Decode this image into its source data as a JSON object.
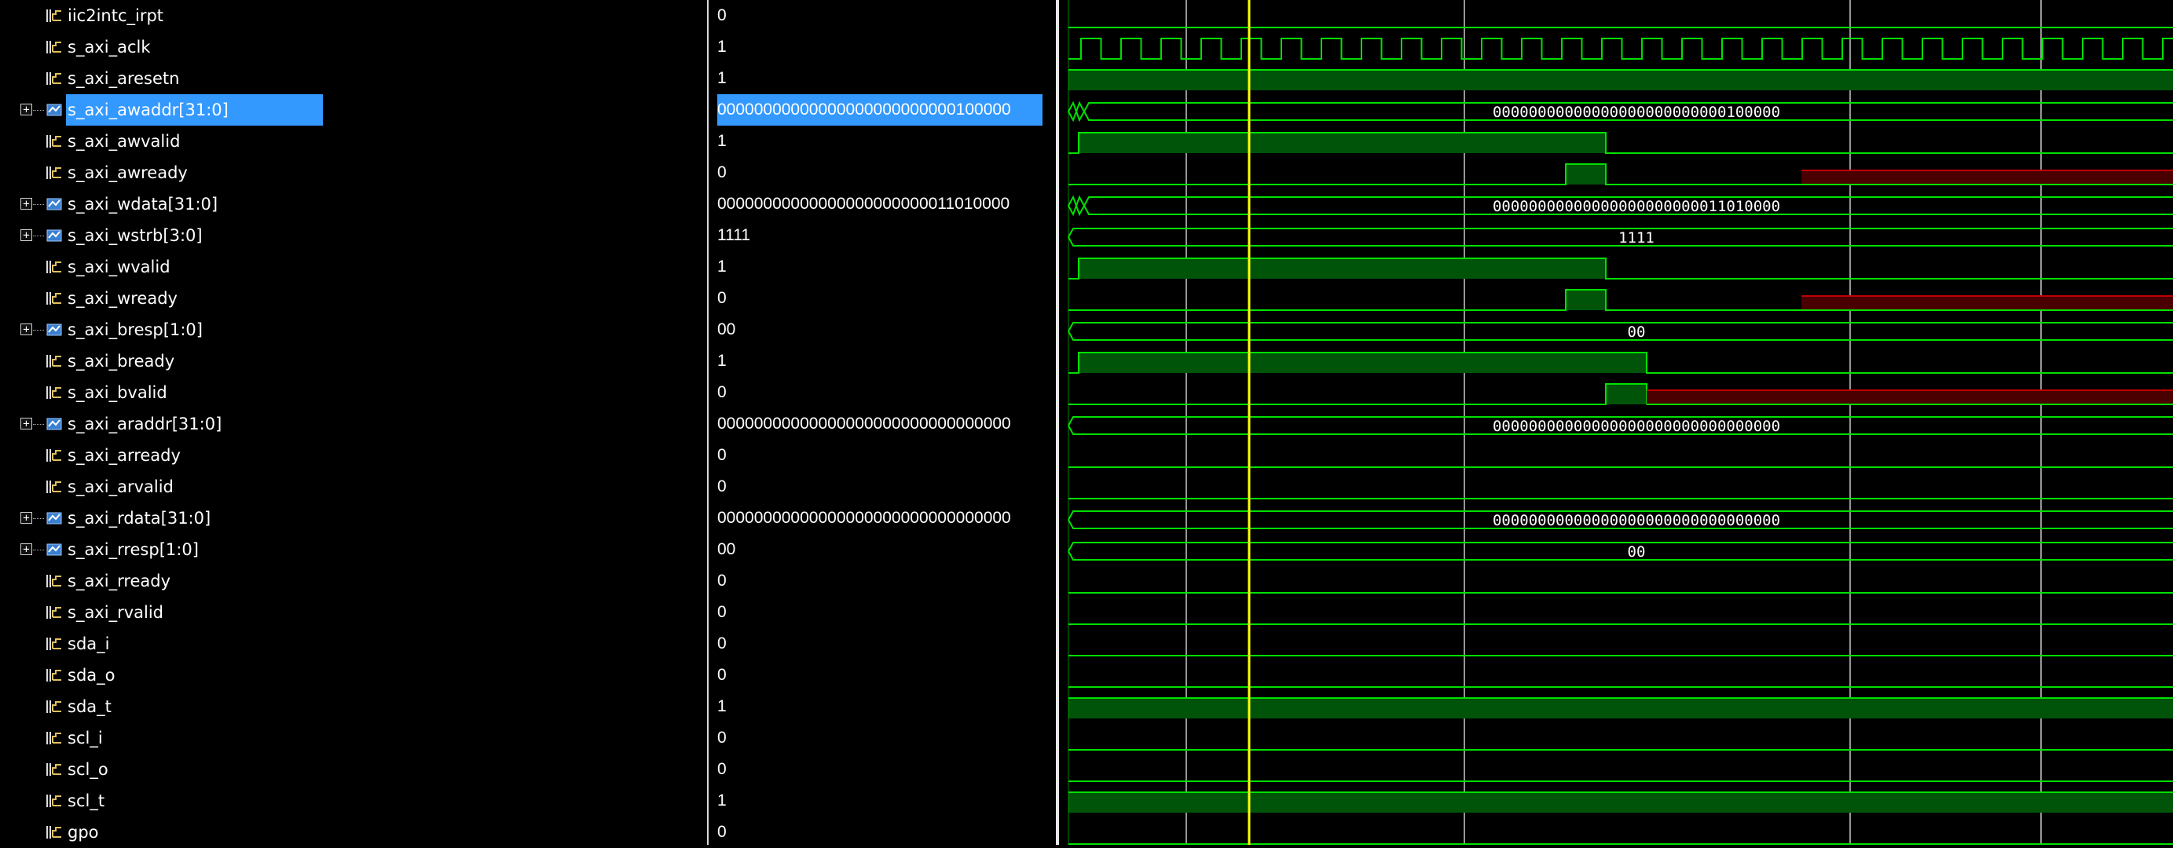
{
  "window": {
    "view": "waveform-viewer"
  },
  "signals": [
    {
      "name": "iic2intc_irpt",
      "value": "0",
      "type": "bit"
    },
    {
      "name": "s_axi_aclk",
      "value": "1",
      "type": "bit"
    },
    {
      "name": "s_axi_aresetn",
      "value": "1",
      "type": "bit"
    },
    {
      "name": "s_axi_awaddr[31:0]",
      "value": "00000000000000000000000000100000",
      "type": "bus",
      "selected": true
    },
    {
      "name": "s_axi_awvalid",
      "value": "1",
      "type": "bit"
    },
    {
      "name": "s_axi_awready",
      "value": "0",
      "type": "bit"
    },
    {
      "name": "s_axi_wdata[31:0]",
      "value": "00000000000000000000000011010000",
      "type": "bus"
    },
    {
      "name": "s_axi_wstrb[3:0]",
      "value": "1111",
      "type": "bus"
    },
    {
      "name": "s_axi_wvalid",
      "value": "1",
      "type": "bit"
    },
    {
      "name": "s_axi_wready",
      "value": "0",
      "type": "bit"
    },
    {
      "name": "s_axi_bresp[1:0]",
      "value": "00",
      "type": "bus"
    },
    {
      "name": "s_axi_bready",
      "value": "1",
      "type": "bit"
    },
    {
      "name": "s_axi_bvalid",
      "value": "0",
      "type": "bit"
    },
    {
      "name": "s_axi_araddr[31:0]",
      "value": "00000000000000000000000000000000",
      "type": "bus"
    },
    {
      "name": "s_axi_arready",
      "value": "0",
      "type": "bit"
    },
    {
      "name": "s_axi_arvalid",
      "value": "0",
      "type": "bit"
    },
    {
      "name": "s_axi_rdata[31:0]",
      "value": "00000000000000000000000000000000",
      "type": "bus"
    },
    {
      "name": "s_axi_rresp[1:0]",
      "value": "00",
      "type": "bus"
    },
    {
      "name": "s_axi_rready",
      "value": "0",
      "type": "bit"
    },
    {
      "name": "s_axi_rvalid",
      "value": "0",
      "type": "bit"
    },
    {
      "name": "sda_i",
      "value": "0",
      "type": "bit"
    },
    {
      "name": "sda_o",
      "value": "0",
      "type": "bit"
    },
    {
      "name": "sda_t",
      "value": "1",
      "type": "bit"
    },
    {
      "name": "scl_i",
      "value": "0",
      "type": "bit"
    },
    {
      "name": "scl_o",
      "value": "0",
      "type": "bit"
    },
    {
      "name": "scl_t",
      "value": "1",
      "type": "bit"
    },
    {
      "name": "gpo",
      "value": "0",
      "type": "bit"
    }
  ],
  "bus_labels": {
    "s_axi_awaddr": "00000000000000000000000000100000",
    "s_axi_wdata": "00000000000000000000000011010000",
    "s_axi_wstrb": "1111",
    "s_axi_bresp": "00",
    "s_axi_araddr": "00000000000000000000000000000000",
    "s_axi_rdata": "00000000000000000000000000000000",
    "s_axi_rresp": "00"
  },
  "colors": {
    "wave_green": "#00e000",
    "wave_fill": "#00540a",
    "undefined_red": "#c00000",
    "cursor_yellow": "#ffff00",
    "grid": "#c8c8c8",
    "selection": "#3399ff"
  },
  "icons": {
    "bit": "single-signal-icon",
    "bus": "bus-signal-icon",
    "expand": "expand-plus-icon"
  },
  "expand_glyph": "+"
}
